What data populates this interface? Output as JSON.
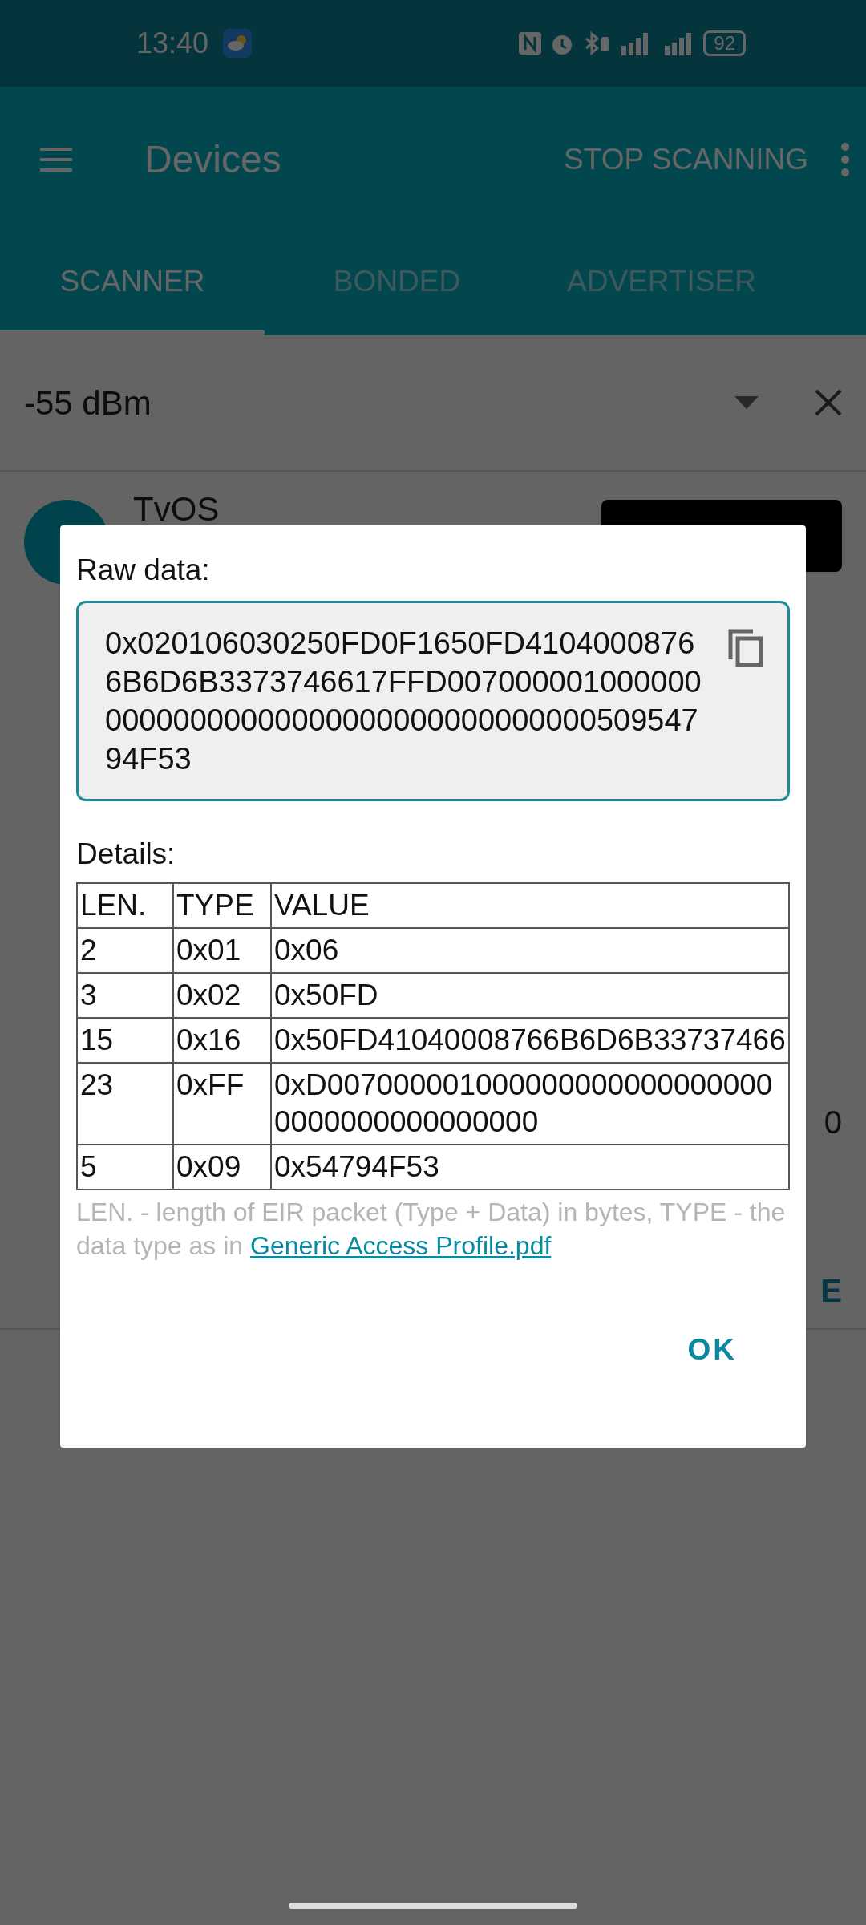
{
  "status_bar": {
    "time": "13:40",
    "battery": "92"
  },
  "app_bar": {
    "title": "Devices",
    "action": "STOP SCANNING"
  },
  "tabs": [
    {
      "label": "SCANNER",
      "selected": true
    },
    {
      "label": "BONDED",
      "selected": false
    },
    {
      "label": "ADVERTISER",
      "selected": false
    }
  ],
  "filter": {
    "rssi": "-55 dBm"
  },
  "device": {
    "name": "TvOS",
    "fragments": [
      "0",
      "E"
    ]
  },
  "dialog": {
    "raw_label": "Raw data:",
    "raw_value": "0x020106030250FD0F1650FD41040008766B6D6B3373746617FFD0070000010000000000000000000000000000000000050954794F53",
    "details_label": "Details:",
    "table": {
      "columns": [
        "LEN.",
        "TYPE",
        "VALUE"
      ],
      "rows": [
        [
          "2",
          "0x01",
          "0x06"
        ],
        [
          "3",
          "0x02",
          "0x50FD"
        ],
        [
          "15",
          "0x16",
          "0x50FD41040008766B6D6B33737466"
        ],
        [
          "23",
          "0xFF",
          "0xD0070000010000000000000000000000000000000000"
        ],
        [
          "5",
          "0x09",
          "0x54794F53"
        ]
      ]
    },
    "note": "LEN. - length of EIR packet (Type + Data) in bytes, TYPE - the data type as in ",
    "note_link": "Generic Access Profile.pdf",
    "button": "OK"
  }
}
